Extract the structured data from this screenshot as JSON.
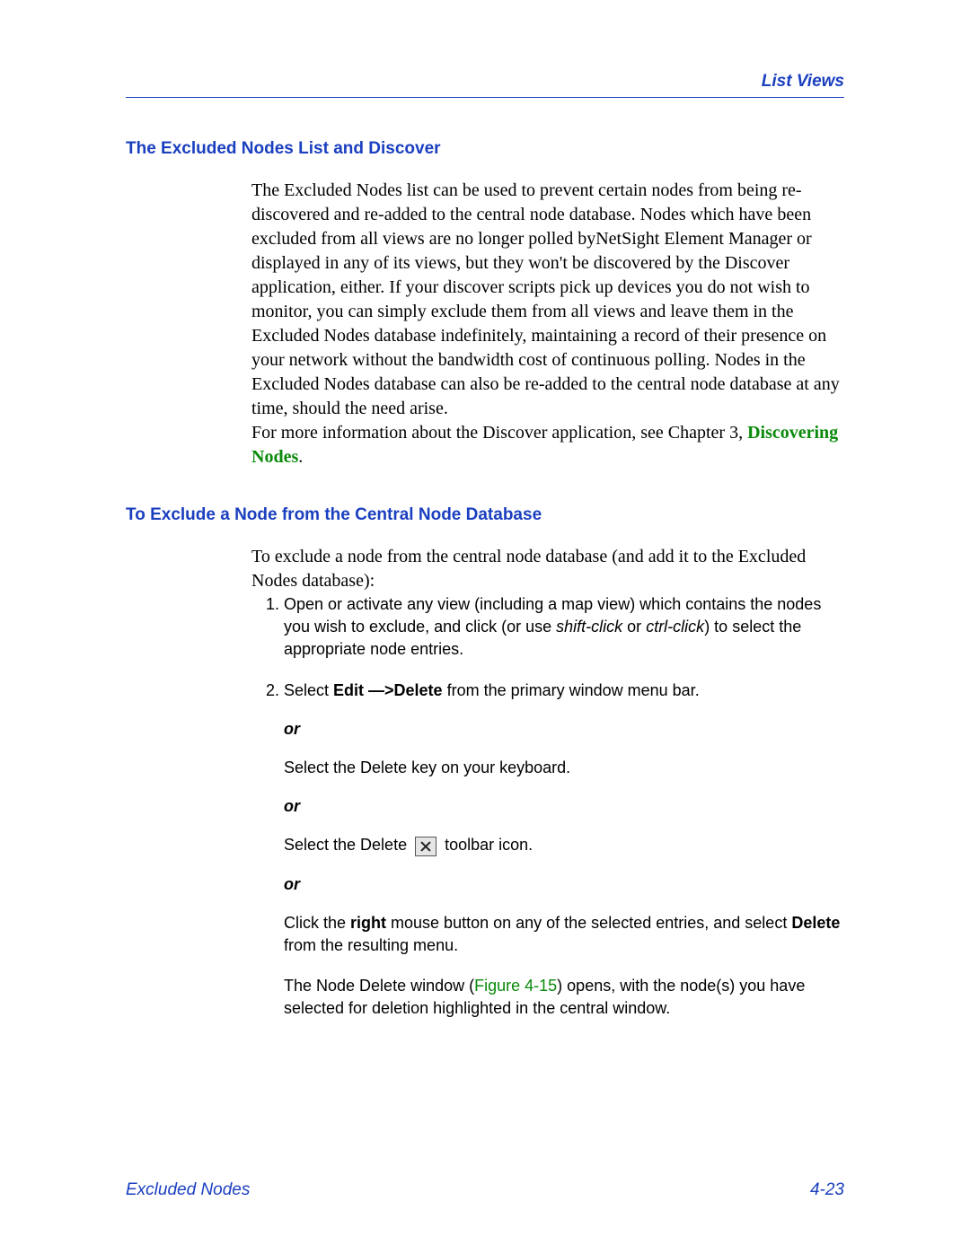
{
  "header": {
    "right": "List Views"
  },
  "section1": {
    "title": "The Excluded Nodes List and Discover",
    "para1": "The Excluded Nodes list can be used to prevent certain nodes from being re-discovered and re-added to the central node database. Nodes which have been excluded from all views are no longer polled byNetSight Element Manager or displayed in any of its views, but they won't be discovered by the Discover application, either. If your discover scripts pick up devices you do not wish to monitor, you can simply exclude them from all views and leave them in the Excluded Nodes database indefinitely, maintaining a record of their presence on your network without the bandwidth cost of continuous polling. Nodes in the Excluded Nodes database can also be re-added to the central node database at any time, should the need arise.",
    "para2_pre": "For more information about the Discover application, see Chapter 3, ",
    "para2_link": "Discovering Nodes",
    "para2_post": "."
  },
  "section2": {
    "title": "To Exclude a Node from the Central Node Database",
    "intro": "To exclude a node from the central node database (and add it to the Excluded Nodes database):",
    "step1_pre": "Open or activate any view (including a map view) which contains the nodes you wish to exclude, and click (or use ",
    "step1_em1": "shift-click",
    "step1_mid": " or ",
    "step1_em2": "ctrl-click",
    "step1_post": ") to select the appropriate node entries.",
    "step2_pre": "Select ",
    "step2_bold": "Edit —>Delete",
    "step2_post": " from the primary window menu bar.",
    "or": "or",
    "alt1": "Select the Delete key on your keyboard.",
    "alt2_pre": "Select the Delete ",
    "alt2_post": " toolbar icon.",
    "alt3_pre": "Click the ",
    "alt3_b1": "right",
    "alt3_mid": " mouse button on any of the selected entries, and select ",
    "alt3_b2": "Delete",
    "alt3_post": " from the resulting menu.",
    "result_pre": "The Node Delete window (",
    "result_fig": "Figure 4-15",
    "result_post": ") opens, with the node(s) you have selected for deletion highlighted in the central window."
  },
  "footer": {
    "left": "Excluded Nodes",
    "right": "4-23"
  }
}
